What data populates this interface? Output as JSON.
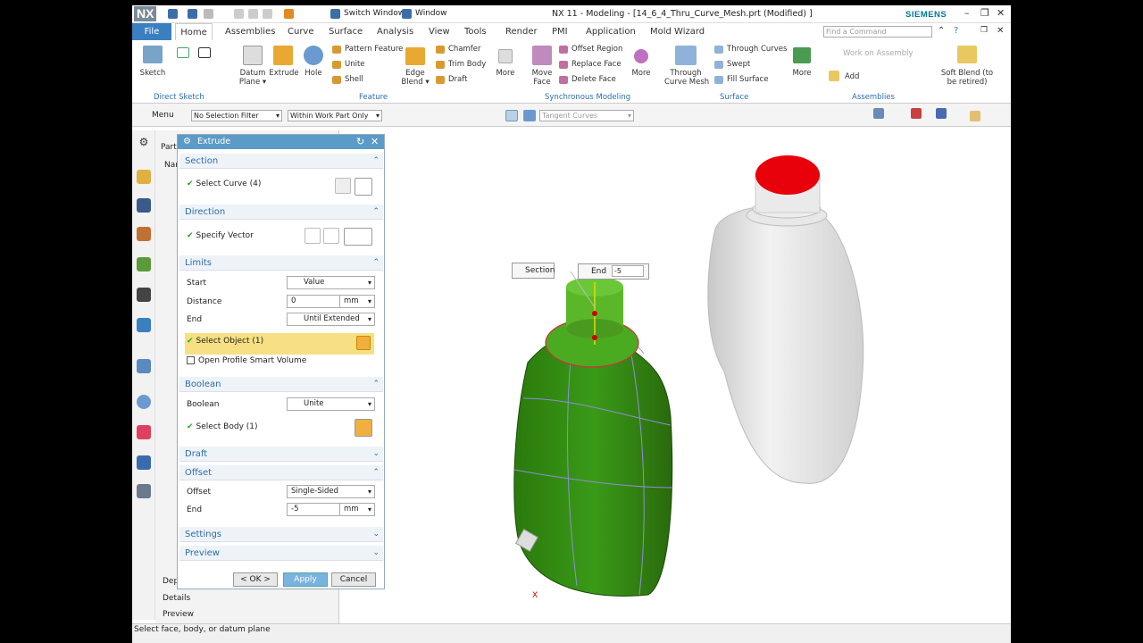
{
  "app": {
    "brand": "NX",
    "title": "NX 11 - Modeling - [14_6_4_Thru_Curve_Mesh.prt (Modified) ]",
    "siemens": "SIEMENS",
    "switch_window": "Switch Window",
    "window": "Window"
  },
  "menu": {
    "tabs": [
      "File",
      "Home",
      "Assemblies",
      "Curve",
      "Surface",
      "Analysis",
      "View",
      "Tools",
      "Render",
      "PMI",
      "Application",
      "Mold Wizard"
    ],
    "find_placeholder": "Find a Command"
  },
  "ribbon": {
    "sketch": "Sketch",
    "direct_sketch": "Direct Sketch",
    "datum_plane": "Datum\nPlane ▾",
    "extrude": "Extrude",
    "hole": "Hole",
    "pattern_feature": "Pattern Feature",
    "unite": "Unite",
    "shell": "Shell",
    "edge_blend": "Edge\nBlend ▾",
    "chamfer": "Chamfer",
    "trim_body": "Trim Body",
    "draft": "Draft",
    "more": "More",
    "feature": "Feature",
    "move_face": "Move\nFace",
    "offset_region": "Offset Region",
    "replace_face": "Replace Face",
    "delete_face": "Delete Face",
    "synch": "Synchronous Modeling",
    "through_curve_mesh": "Through\nCurve Mesh",
    "through_curves": "Through Curves",
    "swept": "Swept",
    "fill_surface": "Fill Surface",
    "surface": "Surface",
    "work_on_assembly": "Work on Assembly",
    "add": "Add",
    "assemblies": "Assemblies",
    "soft_blend": "Soft Blend (to\nbe retired)"
  },
  "toolbar": {
    "menu": "Menu",
    "filter": "No Selection Filter",
    "scope": "Within Work Part Only",
    "curve_rule": "Tangent Curves"
  },
  "nav": {
    "part": "Part",
    "name": "Nam",
    "details": "Details",
    "preview": "Preview",
    "dep": "Dep"
  },
  "dialog": {
    "title": "Extrude",
    "section": "Section",
    "select_curve": "Select Curve (4)",
    "direction": "Direction",
    "specify_vector": "Specify Vector",
    "limits": "Limits",
    "start": "Start",
    "start_val": "Value",
    "distance": "Distance",
    "distance_val": "0",
    "unit": "mm",
    "end": "End",
    "end_val": "Until Extended",
    "select_object": "Select Object (1)",
    "open_profile": "Open Profile Smart Volume",
    "boolean_h": "Boolean",
    "boolean": "Boolean",
    "boolean_val": "Unite",
    "select_body": "Select Body (1)",
    "draft": "Draft",
    "offset_h": "Offset",
    "offset": "Offset",
    "offset_val": "Single-Sided",
    "offset_end": "End",
    "offset_end_val": "-5",
    "settings": "Settings",
    "preview": "Preview",
    "ok": "< OK >",
    "apply": "Apply",
    "cancel": "Cancel"
  },
  "viewport": {
    "section_label": "Section",
    "end_label": "End",
    "end_value": "-5"
  },
  "status": "Select face, body, or datum plane",
  "colors": {
    "accent": "#3a7fc0",
    "body": "#2f8a10",
    "cap": "#e8000b"
  }
}
